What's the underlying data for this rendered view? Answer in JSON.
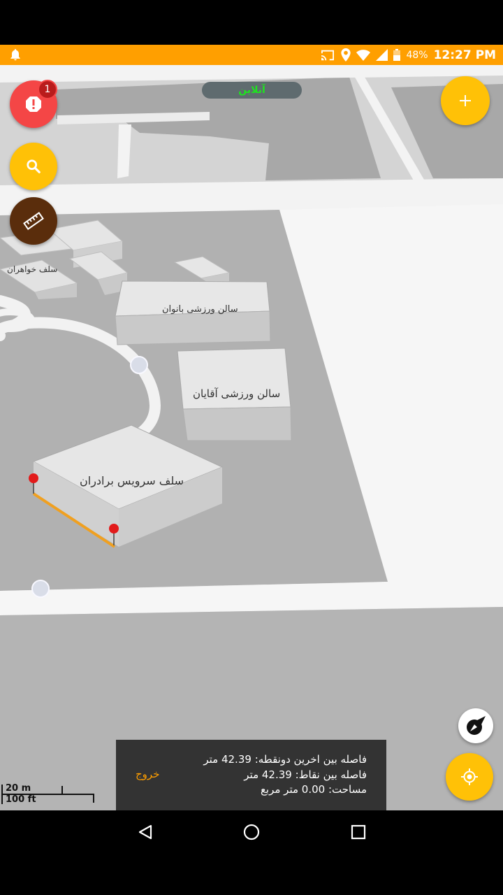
{
  "status_bar": {
    "battery_percent": "48%",
    "time": "12:27 PM",
    "icons": [
      "notification-bell-icon",
      "cast-icon",
      "location-icon",
      "wifi-icon",
      "signal-icon",
      "battery-icon"
    ]
  },
  "online_status": "آنلاین",
  "alerts": {
    "badge_count": "1",
    "icon": "alert-icon"
  },
  "map_labels": {
    "sisters_cafeteria": "سلف خواهران",
    "women_gym": "سالن ورزشی بانوان",
    "men_gym": "سالن ورزشی آقایان",
    "brothers_cafeteria": "سلف سرویس برادران"
  },
  "scale_bar": {
    "metric": "20 m",
    "imperial": "100 ft"
  },
  "measurement": {
    "last_two_points": "فاصله بین اخرین دونقطه: 42.39 متر",
    "points_distance": "فاصله بین نقاط: 42.39 متر",
    "area": "مساحت: 0.00 متر  مربع",
    "exit_label": "خروج"
  },
  "colors": {
    "accent": "#ffc107",
    "status_bar": "#ff9f00",
    "alert": "#f44646",
    "ruler": "#5a2d0c",
    "online_text": "#1ee51e",
    "measure_line": "#f0a020"
  }
}
